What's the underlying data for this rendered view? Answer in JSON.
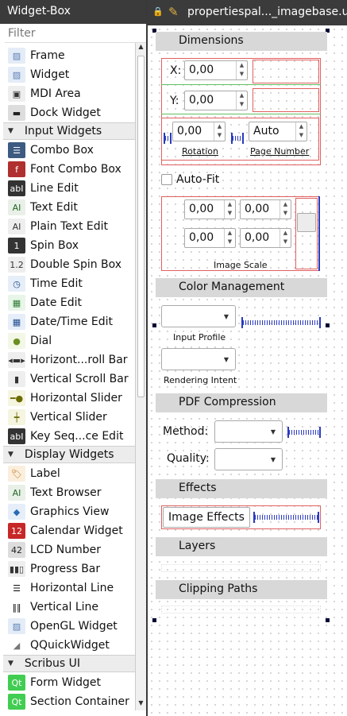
{
  "widget_box": {
    "title": "Widget-Box",
    "filter_placeholder": "Filter",
    "items": [
      {
        "type": "item",
        "label": "Frame",
        "icon": "frame-icon",
        "glyph": "▨",
        "fg": "#5b7fb5",
        "bg": "#e4ecf7"
      },
      {
        "type": "item",
        "label": "Widget",
        "icon": "widget-icon",
        "glyph": "▨",
        "fg": "#5b7fb5",
        "bg": "#e4ecf7"
      },
      {
        "type": "item",
        "label": "MDI Area",
        "icon": "mdi-area-icon",
        "glyph": "▣",
        "fg": "#333",
        "bg": "#eee"
      },
      {
        "type": "item",
        "label": "Dock Widget",
        "icon": "dock-widget-icon",
        "glyph": "▬",
        "fg": "#222",
        "bg": "#ddd"
      },
      {
        "type": "cat",
        "label": "Input Widgets"
      },
      {
        "type": "item",
        "label": "Combo Box",
        "icon": "combo-box-icon",
        "glyph": "☰",
        "fg": "#fff",
        "bg": "#3d5a80"
      },
      {
        "type": "item",
        "label": "Font Combo Box",
        "icon": "font-combo-box-icon",
        "glyph": "f",
        "fg": "#fff",
        "bg": "#b03030"
      },
      {
        "type": "item",
        "label": "Line Edit",
        "icon": "line-edit-icon",
        "glyph": "abI",
        "fg": "#fff",
        "bg": "#333"
      },
      {
        "type": "item",
        "label": "Text Edit",
        "icon": "text-edit-icon",
        "glyph": "AI",
        "fg": "#226622",
        "bg": "#e8f0e8"
      },
      {
        "type": "item",
        "label": "Plain Text Edit",
        "icon": "plain-text-edit-icon",
        "glyph": "AI",
        "fg": "#333",
        "bg": "#eee"
      },
      {
        "type": "item",
        "label": "Spin Box",
        "icon": "spin-box-icon",
        "glyph": "1",
        "fg": "#fff",
        "bg": "#333"
      },
      {
        "type": "item",
        "label": "Double Spin Box",
        "icon": "double-spin-box-icon",
        "glyph": "1.2",
        "fg": "#333",
        "bg": "#eee"
      },
      {
        "type": "item",
        "label": "Time Edit",
        "icon": "time-edit-icon",
        "glyph": "◷",
        "fg": "#1f4e8c",
        "bg": "#e6eef9"
      },
      {
        "type": "item",
        "label": "Date Edit",
        "icon": "date-edit-icon",
        "glyph": "▦",
        "fg": "#2e7d32",
        "bg": "#e8f5e9"
      },
      {
        "type": "item",
        "label": "Date/Time Edit",
        "icon": "date-time-edit-icon",
        "glyph": "▦",
        "fg": "#1f4e8c",
        "bg": "#e6eef9"
      },
      {
        "type": "item",
        "label": "Dial",
        "icon": "dial-icon",
        "glyph": "●",
        "fg": "#6b8e23",
        "bg": "#f3f7e6"
      },
      {
        "type": "item",
        "label": "Horizont...roll Bar",
        "icon": "horizontal-scroll-bar-icon",
        "glyph": "◂▬▸",
        "fg": "#333",
        "bg": "#eee"
      },
      {
        "type": "item",
        "label": "Vertical Scroll Bar",
        "icon": "vertical-scroll-bar-icon",
        "glyph": "▮",
        "fg": "#333",
        "bg": "#eee"
      },
      {
        "type": "item",
        "label": "Horizontal Slider",
        "icon": "horizontal-slider-icon",
        "glyph": "━●",
        "fg": "#6b6b00",
        "bg": "#f5f5e0"
      },
      {
        "type": "item",
        "label": "Vertical Slider",
        "icon": "vertical-slider-icon",
        "glyph": "┿",
        "fg": "#6b6b00",
        "bg": "#f5f5e0"
      },
      {
        "type": "item",
        "label": "Key Seq...ce Edit",
        "icon": "key-sequence-edit-icon",
        "glyph": "abI",
        "fg": "#fff",
        "bg": "#333"
      },
      {
        "type": "cat",
        "label": "Display Widgets"
      },
      {
        "type": "item",
        "label": "Label",
        "icon": "label-icon",
        "glyph": "🏷",
        "fg": "#c0701b",
        "bg": "#fbeedd"
      },
      {
        "type": "item",
        "label": "Text Browser",
        "icon": "text-browser-icon",
        "glyph": "AI",
        "fg": "#226622",
        "bg": "#e8f0e8"
      },
      {
        "type": "item",
        "label": "Graphics View",
        "icon": "graphics-view-icon",
        "glyph": "◆",
        "fg": "#2a6bb5",
        "bg": "#e6eef9"
      },
      {
        "type": "item",
        "label": "Calendar Widget",
        "icon": "calendar-widget-icon",
        "glyph": "12",
        "fg": "#fff",
        "bg": "#c62828"
      },
      {
        "type": "item",
        "label": "LCD Number",
        "icon": "lcd-number-icon",
        "glyph": "42",
        "fg": "#222",
        "bg": "#ddd"
      },
      {
        "type": "item",
        "label": "Progress Bar",
        "icon": "progress-bar-icon",
        "glyph": "▮▮▯",
        "fg": "#333",
        "bg": "#eee"
      },
      {
        "type": "item",
        "label": "Horizontal Line",
        "icon": "horizontal-line-icon",
        "glyph": "☰",
        "fg": "#111",
        "bg": "#fff"
      },
      {
        "type": "item",
        "label": "Vertical Line",
        "icon": "vertical-line-icon",
        "glyph": "‖‖",
        "fg": "#111",
        "bg": "#fff"
      },
      {
        "type": "item",
        "label": "OpenGL Widget",
        "icon": "opengl-widget-icon",
        "glyph": "▨",
        "fg": "#5b7fb5",
        "bg": "#e4ecf7"
      },
      {
        "type": "item",
        "label": "QQuickWidget",
        "icon": "qquickwidget-icon",
        "glyph": "◢",
        "fg": "#777",
        "bg": "#fff"
      },
      {
        "type": "cat",
        "label": "Scribus UI"
      },
      {
        "type": "item",
        "label": "Form Widget",
        "icon": "form-widget-icon",
        "glyph": "Qt",
        "fg": "#fff",
        "bg": "#41cd52"
      },
      {
        "type": "item",
        "label": "Section Container",
        "icon": "section-container-icon",
        "glyph": "Qt",
        "fg": "#fff",
        "bg": "#41cd52"
      }
    ]
  },
  "editor_tab": {
    "title": "propertiespal..._imagebase.u"
  },
  "form": {
    "dimensions_title": "Dimensions",
    "x_label": "X:",
    "x_value": "0,00",
    "y_label": "Y:",
    "y_value": "0,00",
    "rotation_value": "0,00",
    "rotation_label": "Rotation",
    "page_number_value": "Auto",
    "page_number_label": "Page Number",
    "auto_fit_label": "Auto-Fit",
    "scale_x1": "0,00",
    "scale_x2": "0,00",
    "scale_y1": "0,00",
    "scale_y2": "0,00",
    "image_scale_label": "Image Scale",
    "color_management_title": "Color Management",
    "input_profile_label": "Input Profile",
    "rendering_intent_label": "Rendering Intent",
    "pdf_compression_title": "PDF Compression",
    "method_label": "Method:",
    "quality_label": "Quality:",
    "effects_title": "Effects",
    "image_effects_button": "Image Effects",
    "layers_title": "Layers",
    "clipping_paths_title": "Clipping Paths"
  },
  "colors": {
    "layout_red": "#e06060",
    "spacer_blue": "#2b3bbf",
    "section_gray": "#d8d8d8"
  }
}
